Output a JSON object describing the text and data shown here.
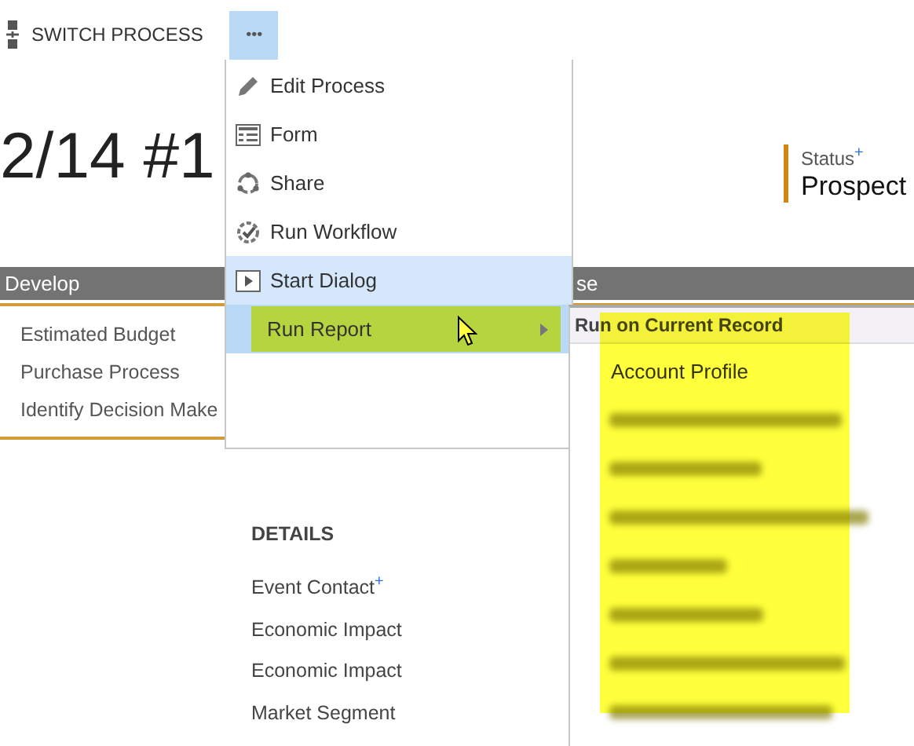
{
  "toolbar": {
    "switch_label": "SWITCH PROCESS",
    "more_label": "•••",
    "more_open": true
  },
  "title": "2/14 #1",
  "status": {
    "label": "Status",
    "required_mark": "+",
    "value": "Prospect"
  },
  "stage_bar": {
    "current": "Develop",
    "next_partial": "se"
  },
  "stage_fields": [
    "Estimated Budget",
    "Purchase Process",
    "Identify Decision Make"
  ],
  "details": {
    "heading": "DETAILS",
    "fields": [
      {
        "label": "Event Contact",
        "required_mark": "+"
      },
      {
        "label": "Economic Impact"
      },
      {
        "label": "Economic Impact"
      },
      {
        "label": "Market Segment"
      }
    ]
  },
  "menu": [
    {
      "label": "Edit Process",
      "kind": "edit",
      "hovered": false,
      "selected": false
    },
    {
      "label": "Form",
      "kind": "form",
      "hovered": false,
      "selected": false
    },
    {
      "label": "Share",
      "kind": "share",
      "hovered": false,
      "selected": false
    },
    {
      "label": "Run Workflow",
      "kind": "workflow",
      "hovered": false,
      "selected": false
    },
    {
      "label": "Start Dialog",
      "kind": "dialog",
      "hovered": true,
      "selected": false
    },
    {
      "label": "Run Report",
      "kind": "submenu",
      "hovered": false,
      "selected": true
    }
  ],
  "report_menu": {
    "header": "Run on Current Record",
    "highlighted": true,
    "items": [
      {
        "kind": "text",
        "label": "Account Profile"
      },
      {
        "kind": "blurred"
      },
      {
        "kind": "blurred"
      },
      {
        "kind": "blurred"
      },
      {
        "kind": "blurred"
      },
      {
        "kind": "blurred"
      },
      {
        "kind": "blurred"
      },
      {
        "kind": "blurred"
      }
    ]
  }
}
